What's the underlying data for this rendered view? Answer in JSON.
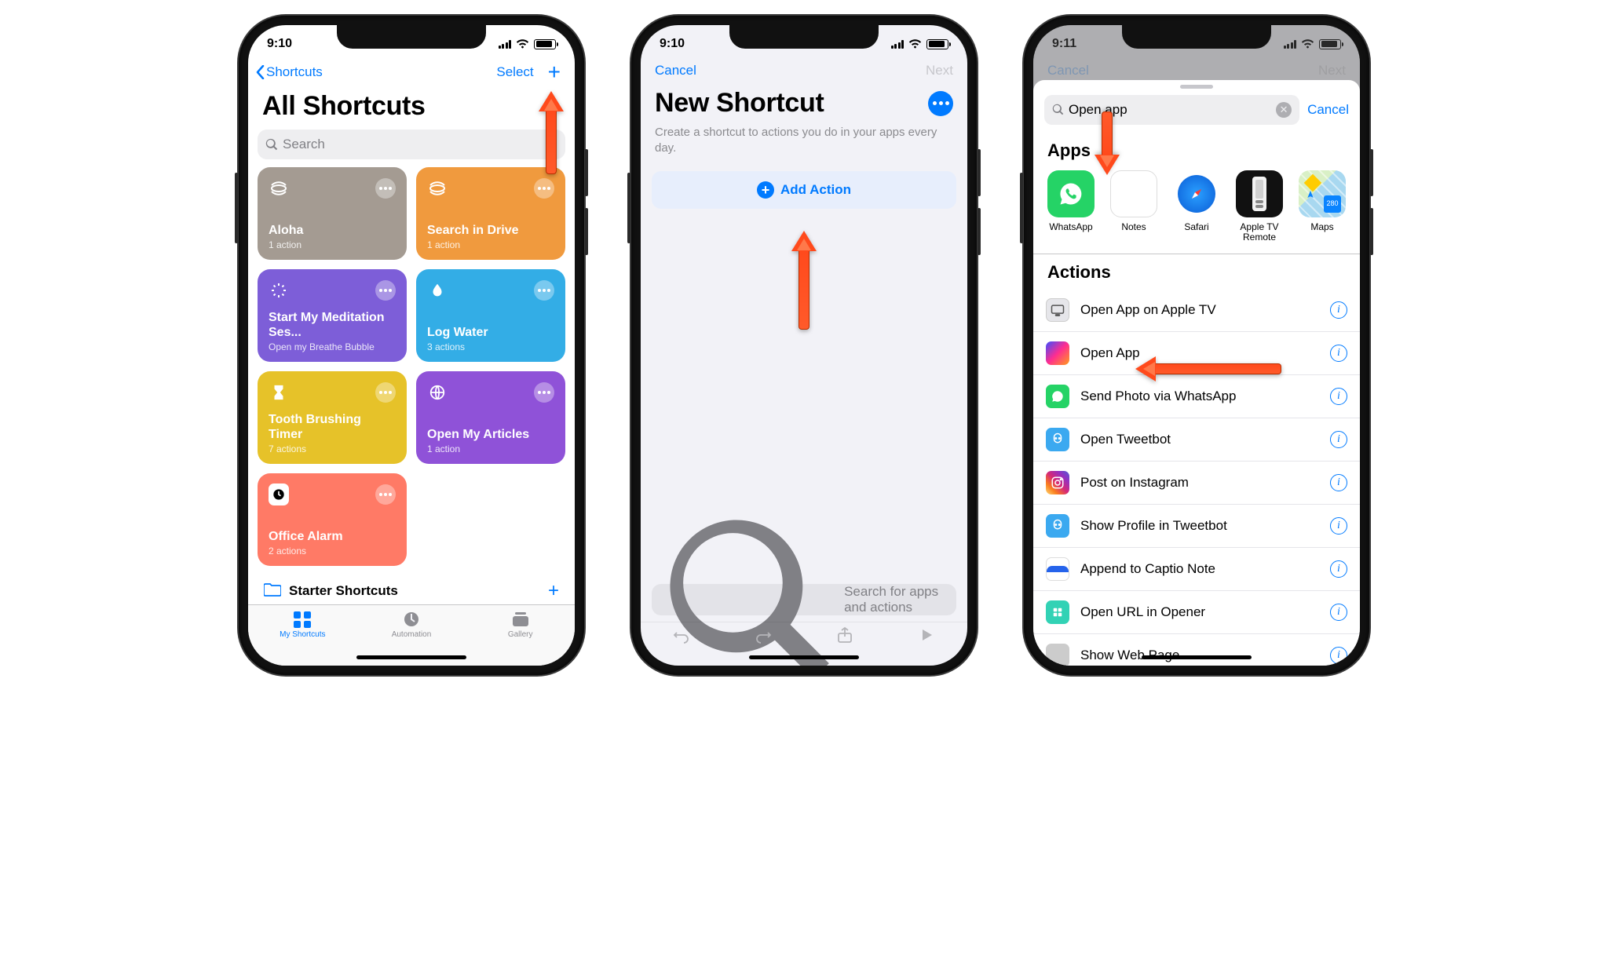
{
  "screen1": {
    "time": "9:10",
    "back_label": "Shortcuts",
    "select_label": "Select",
    "title": "All Shortcuts",
    "search_placeholder": "Search",
    "tiles": [
      {
        "title": "Aloha",
        "sub": "1 action",
        "color": "#a49b92"
      },
      {
        "title": "Search in Drive",
        "sub": "1 action",
        "color": "#f09a3e"
      },
      {
        "title": "Start My Meditation Ses...",
        "sub": "Open my Breathe Bubble",
        "color": "#7d5ed8"
      },
      {
        "title": "Log Water",
        "sub": "3 actions",
        "color": "#33ade6"
      },
      {
        "title": "Tooth Brushing Timer",
        "sub": "7 actions",
        "color": "#e6c229"
      },
      {
        "title": "Open My Articles",
        "sub": "1 action",
        "color": "#8f52d8"
      },
      {
        "title": "Office Alarm",
        "sub": "2 actions",
        "color": "#ff7a66"
      }
    ],
    "folder_label": "Starter Shortcuts",
    "tabs": {
      "my": "My Shortcuts",
      "auto": "Automation",
      "gallery": "Gallery"
    }
  },
  "screen2": {
    "time": "9:10",
    "cancel": "Cancel",
    "next": "Next",
    "title": "New Shortcut",
    "desc": "Create a shortcut to actions you do in your apps every day.",
    "add_action": "Add Action",
    "bottom_search_placeholder": "Search for apps and actions"
  },
  "screen3": {
    "time": "9:11",
    "search_value": "Open app",
    "cancel": "Cancel",
    "apps_header": "Apps",
    "apps": [
      {
        "name": "WhatsApp",
        "color": "#25d366"
      },
      {
        "name": "Notes",
        "color": "#fff"
      },
      {
        "name": "Safari",
        "color": "#fff"
      },
      {
        "name": "Apple TV Remote",
        "color": "#111"
      },
      {
        "name": "Maps",
        "color": "#fff"
      }
    ],
    "actions_header": "Actions",
    "actions": [
      {
        "title": "Open App on Apple TV",
        "color": "#e6e6ea"
      },
      {
        "title": "Open App",
        "color": "shortcuts"
      },
      {
        "title": "Send Photo via WhatsApp",
        "color": "#25d366"
      },
      {
        "title": "Open Tweetbot",
        "color": "#3ba9f0"
      },
      {
        "title": "Post on Instagram",
        "color": "instagram"
      },
      {
        "title": "Show Profile in Tweetbot",
        "color": "#3ba9f0"
      },
      {
        "title": "Append to Captio Note",
        "color": "#f2f2f7"
      },
      {
        "title": "Open URL in Opener",
        "color": "#32d2b5"
      },
      {
        "title": "Show Web Page",
        "color": ""
      }
    ]
  }
}
